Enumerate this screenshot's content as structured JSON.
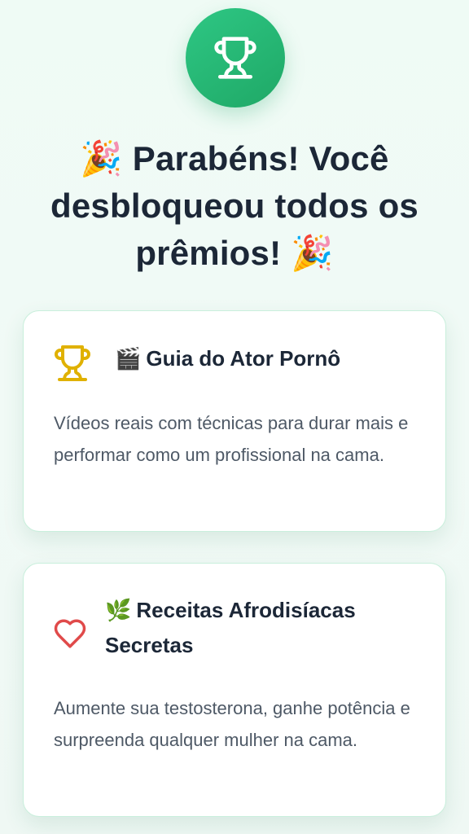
{
  "header": {
    "icon": "trophy-icon",
    "title_emoji_start": "🎉",
    "title_text": "Parabéns! Você desbloqueou todos os prêmios!",
    "title_emoji_end": "🎉"
  },
  "rewards": [
    {
      "icon": "trophy-icon",
      "icon_color": "#e0b100",
      "emoji": "🎬",
      "title": "Guia do Ator Pornô",
      "description": "Vídeos reais com técnicas para durar mais e performar como um profissional na cama."
    },
    {
      "icon": "heart-icon",
      "icon_color": "#e04a4a",
      "emoji": "🌿",
      "title": "Receitas Afrodisíacas Secretas",
      "description": "Aumente sua testosterona, ganhe potência e surpreenda qualquer mulher na cama."
    }
  ],
  "colors": {
    "accent": "#22b573",
    "background": "#effbf5",
    "card_border": "#c9efdc",
    "text_primary": "#1c2737",
    "text_secondary": "#4e5966"
  }
}
